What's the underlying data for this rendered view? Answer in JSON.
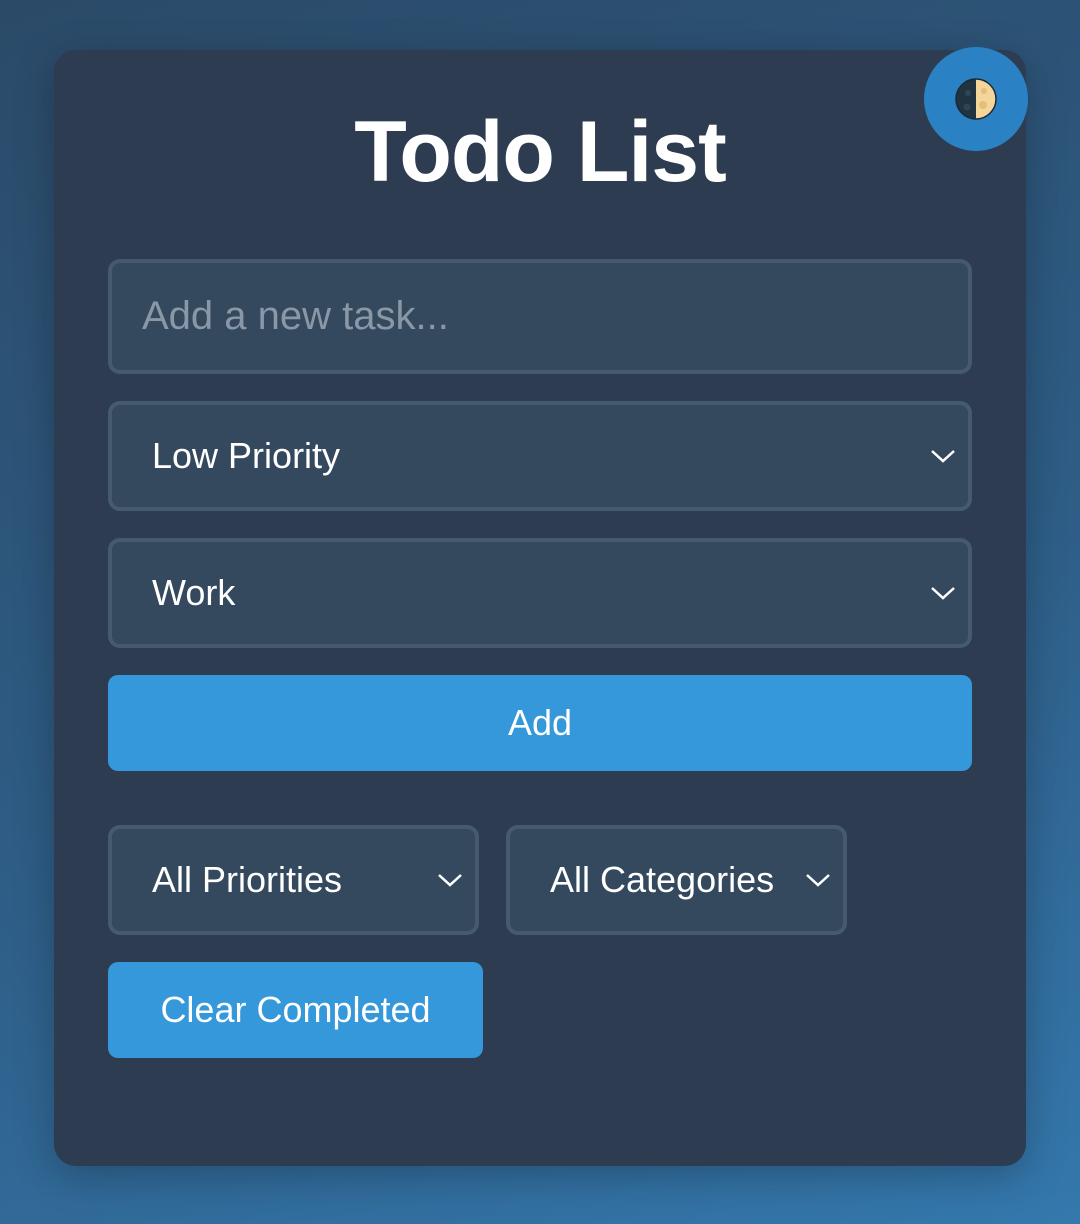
{
  "app": {
    "title": "Todo List"
  },
  "theme_toggle": {
    "icon": "half-moon-icon"
  },
  "new_task": {
    "value": "",
    "placeholder": "Add a new task..."
  },
  "priority_select": {
    "selected": "Low Priority"
  },
  "category_select": {
    "selected": "Work"
  },
  "add_button": {
    "label": "Add"
  },
  "filters": {
    "priority": {
      "selected": "All Priorities"
    },
    "category": {
      "selected": "All Categories"
    }
  },
  "clear_button": {
    "label": "Clear Completed"
  },
  "colors": {
    "background": "#2e5d86",
    "card": "#2d3c50",
    "field": "#34495e",
    "field_border": "#465a6f",
    "accent": "#3498db",
    "toggle": "#2a82c4"
  }
}
